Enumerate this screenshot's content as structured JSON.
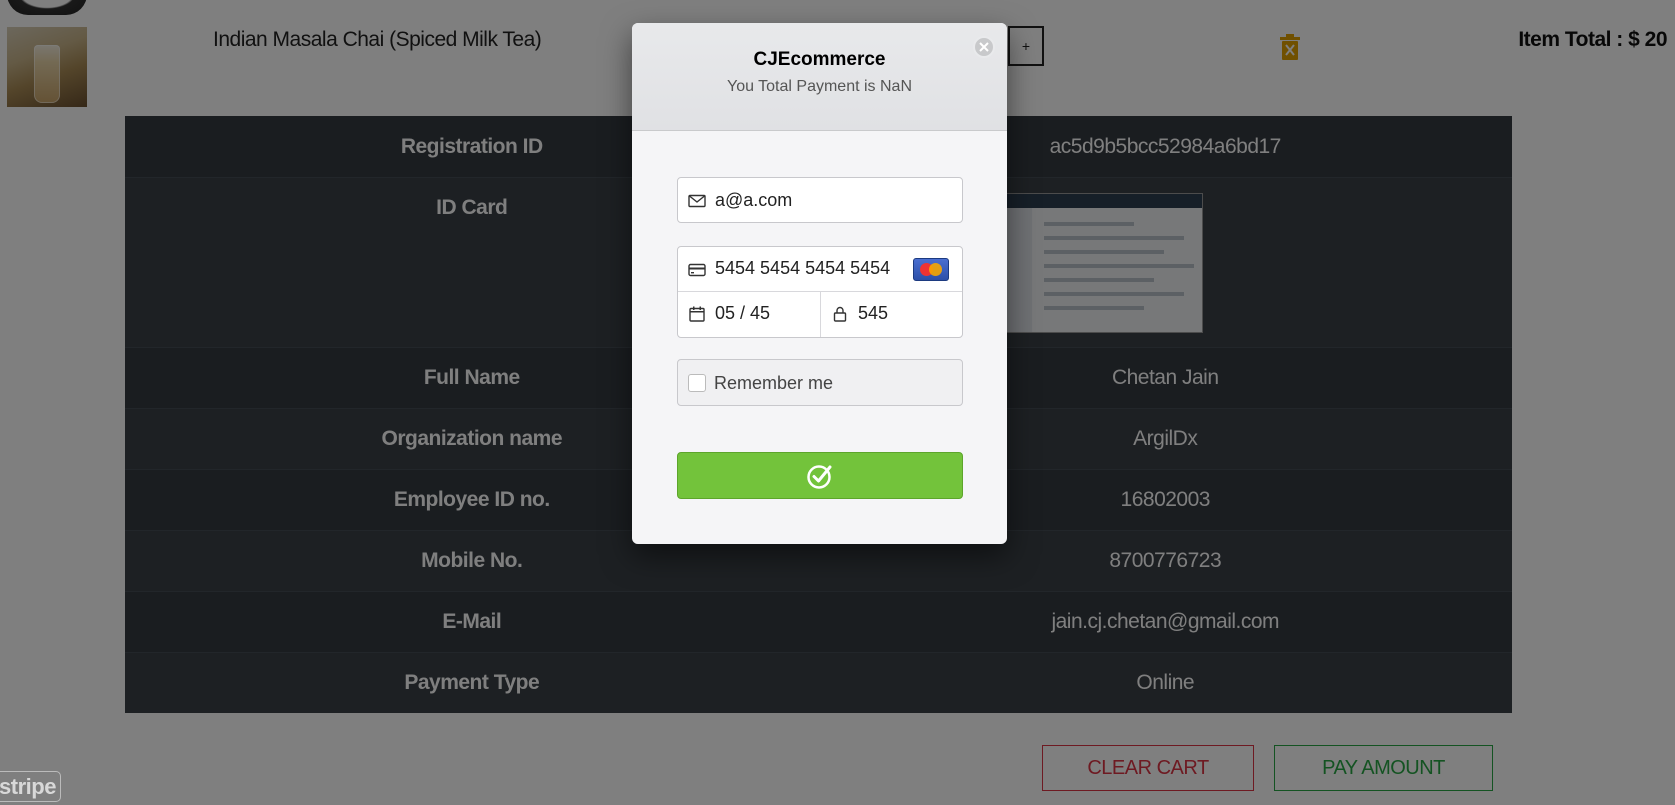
{
  "cart": {
    "item_name": "Indian Masala Chai (Spiced Milk Tea)",
    "qty_plus": "+",
    "item_total": "Item Total : $ 20"
  },
  "details": {
    "rows": [
      {
        "label": "Registration ID",
        "value": "ac5d9b5bcc52984a6bd17"
      },
      {
        "label": "ID Card",
        "value": ""
      },
      {
        "label": "Full Name",
        "value": "Chetan Jain"
      },
      {
        "label": "Organization name",
        "value": "ArgilDx"
      },
      {
        "label": "Employee ID no.",
        "value": "16802003"
      },
      {
        "label": "Mobile No.",
        "value": "8700776723"
      },
      {
        "label": "E-Mail",
        "value": "jain.cj.chetan@gmail.com"
      },
      {
        "label": "Payment Type",
        "value": "Online"
      }
    ]
  },
  "actions": {
    "clear_cart": "CLEAR CART",
    "pay_amount": "PAY AMOUNT"
  },
  "stripe_badge": "stripe",
  "checkout": {
    "title": "CJEcommerce",
    "subtitle": "You Total Payment is NaN",
    "email": "a@a.com",
    "card_number": "5454 5454 5454 5454",
    "expiry": "05 / 45",
    "cvc": "545",
    "remember_label": "Remember me",
    "submit_color": "#73c33b"
  }
}
